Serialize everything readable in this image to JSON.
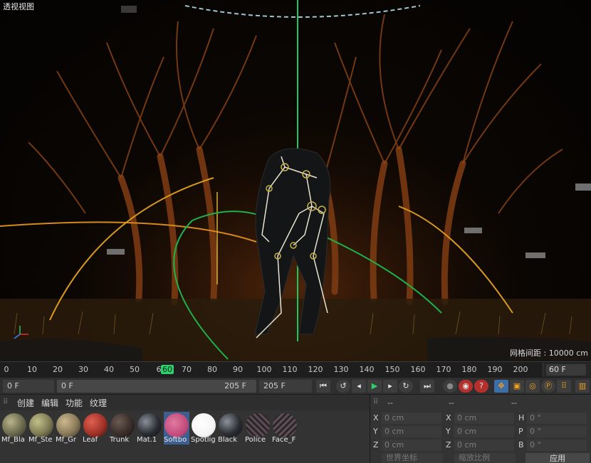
{
  "viewport": {
    "title": "透视视图",
    "grid_spacing": "网格间距 : 10000 cm"
  },
  "timeline": {
    "ticks": [
      "0",
      "10",
      "20",
      "30",
      "40",
      "50",
      "60",
      "70",
      "80",
      "90",
      "100",
      "110",
      "120",
      "130",
      "140",
      "150",
      "160",
      "170",
      "180",
      "190",
      "200"
    ],
    "current_frame_label": "60",
    "current_frame_prefix": "6",
    "end_field": "60 F"
  },
  "transport": {
    "start_field": "0 F",
    "range_start": "0 F",
    "range_end": "205 F",
    "max_field": "205 F",
    "buttons": [
      "go-start",
      "record-key",
      "prev-key",
      "play",
      "next-key",
      "next-frame",
      "go-end"
    ]
  },
  "materials": {
    "menu": [
      "创建",
      "编辑",
      "功能",
      "纹理"
    ],
    "items": [
      {
        "name": "Mf_Bla",
        "color": "#6b6a4e"
      },
      {
        "name": "Mf_Ste",
        "color": "#7d7a55"
      },
      {
        "name": "Mf_Gr",
        "color": "#8a7a5a"
      },
      {
        "name": "Leaf",
        "color": "#a23228"
      },
      {
        "name": "Trunk",
        "color": "#3a2e2a"
      },
      {
        "name": "Mat.1",
        "color": "#2a2d33"
      },
      {
        "name": "Softbo",
        "color": "#c24b7c",
        "selected": true
      },
      {
        "name": "Spotlig",
        "color": "#f4f4f4"
      },
      {
        "name": "Black",
        "color": "#2b2e33"
      },
      {
        "name": "Police",
        "color": "#3a3036"
      },
      {
        "name": "Face_F",
        "color": "#3b3438"
      }
    ]
  },
  "coordinates": {
    "headers": [
      "--",
      "--",
      "--"
    ],
    "rows": [
      {
        "l1": "X",
        "v1": "0 cm",
        "l2": "X",
        "v2": "0 cm",
        "l3": "H",
        "v3": "0 °"
      },
      {
        "l1": "Y",
        "v1": "0 cm",
        "l2": "Y",
        "v2": "0 cm",
        "l3": "P",
        "v3": "0 °"
      },
      {
        "l1": "Z",
        "v1": "0 cm",
        "l2": "Z",
        "v2": "0 cm",
        "l3": "B",
        "v3": "0 °"
      }
    ],
    "space_dropdown": "世界坐标",
    "scale_dropdown": "缩放比例",
    "apply_label": "应用"
  }
}
